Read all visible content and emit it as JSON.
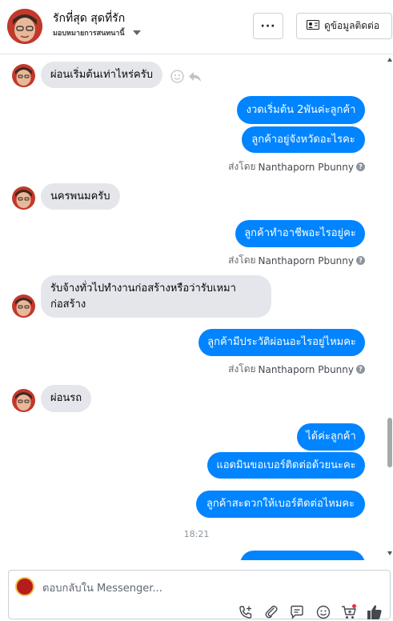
{
  "header": {
    "contact_name": "รักที่สุด สุดที่รัก",
    "assign_label": "มอบหมายการสนทนานี้",
    "more_label": "···",
    "contact_info_label": "ดูข้อมูลติดต่อ"
  },
  "messages": [
    {
      "dir": "in",
      "text": "ผ่อนเริ่มต้นเท่าไหร่ครับ"
    },
    {
      "dir": "out",
      "text": "งวดเริ่มต้น 2พันค่ะลูกค้า"
    },
    {
      "dir": "out",
      "text": "ลูกค้าอยู่จังหวัดอะไรคะ"
    },
    {
      "dir": "in",
      "text": "นครพนมครับ"
    },
    {
      "dir": "out",
      "text": "ลูกค้าทำอาชีพอะไรอยู่คะ"
    },
    {
      "dir": "in",
      "text_line1": "รับจ้างทั่วไปทำงานก่อสร้างหรือว่ารับเหมา",
      "text_line2": "ก่อสร้าง"
    },
    {
      "dir": "out",
      "text": "ลูกค้ามีประวัติผ่อนอะไรอยู่ไหมคะ"
    },
    {
      "dir": "in",
      "text": "ผ่อนรถ"
    },
    {
      "dir": "out",
      "text": "ได้ค่ะลูกค้า"
    },
    {
      "dir": "out",
      "text": "แอดมินขอเบอร์ติดต่อด้วยนะคะ"
    },
    {
      "dir": "out",
      "text": "ลูกค้าสะดวกให้เบอร์ติดต่อไหมคะ"
    }
  ],
  "sent_by": {
    "prefix": "ส่งโดย",
    "name": "Nanthaporn Pbunny",
    "help_icon": "?"
  },
  "timestamp": "18:21",
  "composer": {
    "placeholder": "ตอบกลับใน Messenger..."
  },
  "icons": [
    "smile-icon",
    "reply-icon",
    "add-call-icon",
    "attachment-icon",
    "saved-reply-icon",
    "emoji-icon",
    "cart-icon",
    "like-icon"
  ],
  "colors": {
    "outgoing_bubble": "#0084ff",
    "incoming_bubble": "#e4e6eb",
    "notification_dot": "#f02849"
  }
}
